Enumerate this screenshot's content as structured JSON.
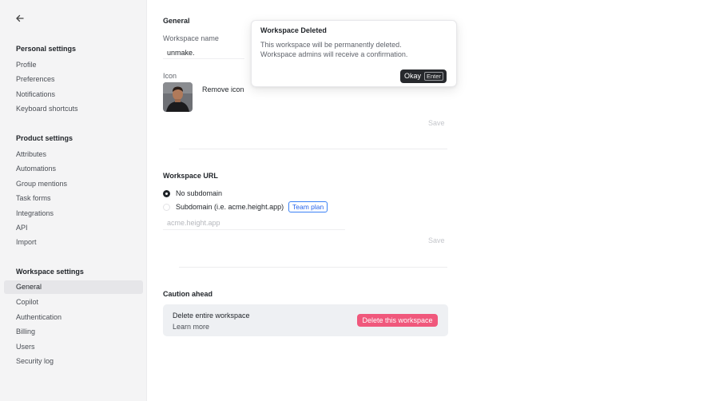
{
  "sidebar": {
    "personal_title": "Personal settings",
    "personal_items": [
      "Profile",
      "Preferences",
      "Notifications",
      "Keyboard shortcuts"
    ],
    "product_title": "Product settings",
    "product_items": [
      "Attributes",
      "Automations",
      "Group mentions",
      "Task forms",
      "Integrations",
      "API",
      "Import"
    ],
    "workspace_title": "Workspace settings",
    "workspace_items": [
      "General",
      "Copilot",
      "Authentication",
      "Billing",
      "Users",
      "Security log"
    ],
    "active_item": "General"
  },
  "general": {
    "title": "General",
    "name_label": "Workspace name",
    "name_value": "unmake.",
    "icon_label": "Icon",
    "remove_icon": "Remove icon",
    "save": "Save"
  },
  "url": {
    "title": "Workspace URL",
    "option_none": "No subdomain",
    "option_sub": "Subdomain (i.e. acme.height.app)",
    "badge": "Team plan",
    "placeholder": "acme.height.app",
    "save": "Save",
    "selected": "No subdomain"
  },
  "caution": {
    "title": "Caution ahead",
    "delete_title": "Delete entire workspace",
    "learn_more": "Learn more",
    "delete_button": "Delete this workspace"
  },
  "dialog": {
    "title": "Workspace Deleted",
    "line1": "This workspace will be permanently deleted.",
    "line2": "Workspace admins will receive a confirmation.",
    "ok_label": "Okay",
    "ok_key": "Enter"
  },
  "colors": {
    "danger": "#f0587c",
    "accent": "#2563eb"
  }
}
